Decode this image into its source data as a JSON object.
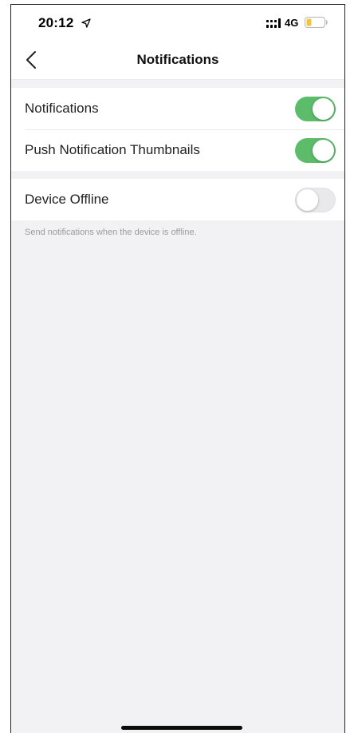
{
  "status_bar": {
    "time": "20:12",
    "network": "4G",
    "icons": [
      "location-arrow-icon",
      "signal-bars-icon",
      "battery-icon"
    ],
    "battery_color": "#f5c43b"
  },
  "nav": {
    "back_icon": "chevron-left-icon",
    "title": "Notifications"
  },
  "settings": [
    {
      "label": "Notifications",
      "enabled": true
    },
    {
      "label": "Push Notification Thumbnails",
      "enabled": true
    },
    {
      "label": "Device Offline",
      "enabled": false
    }
  ],
  "device_offline_note": "Send notifications when the device is offline.",
  "colors": {
    "toggle_on": "#5cbc6a",
    "toggle_off": "#e9e9eb",
    "background": "#f2f2f4"
  }
}
